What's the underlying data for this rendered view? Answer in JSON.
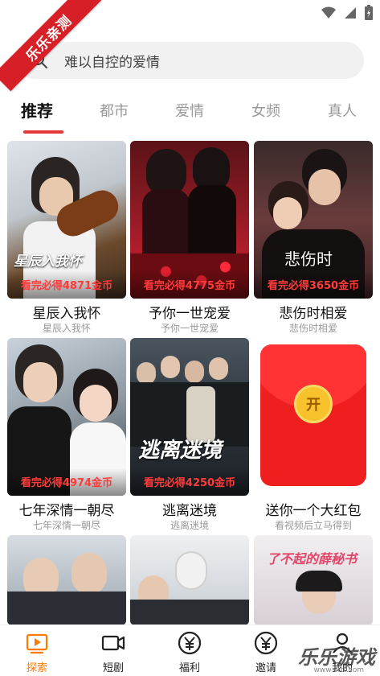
{
  "ribbon": "乐乐亲测",
  "search": {
    "placeholder": "难以自控的爱情"
  },
  "tabs": [
    {
      "label": "推荐",
      "active": true
    },
    {
      "label": "都市"
    },
    {
      "label": "爱情"
    },
    {
      "label": "女频"
    },
    {
      "label": "真人"
    }
  ],
  "cards": [
    {
      "title": "星辰入我怀",
      "sub": "星辰入我怀",
      "coin": "看完必得4871金币",
      "poster_text": "星辰入我怀"
    },
    {
      "title": "予你一世宠爱",
      "sub": "予你一世宠爱",
      "coin": "看完必得4775金币",
      "poster_text": ""
    },
    {
      "title": "悲伤时相爱",
      "sub": "悲伤时相爱",
      "coin": "看完必得3650金币",
      "poster_text": "悲伤时"
    },
    {
      "title": "七年深情一朝尽",
      "sub": "七年深情一朝尽",
      "coin": "看完必得4974金币",
      "poster_text": ""
    },
    {
      "title": "逃离迷境",
      "sub": "逃离迷境",
      "coin": "看完必得4250金币",
      "poster_text": "逃离迷境"
    },
    {
      "title": "送你一个大红包",
      "sub": "看视频后立马得到",
      "coin": "",
      "poster_text": "开"
    },
    {
      "title": "",
      "sub": "",
      "coin": "",
      "poster_text": ""
    },
    {
      "title": "",
      "sub": "",
      "coin": "",
      "poster_text": ""
    },
    {
      "title": "",
      "sub": "",
      "coin": "",
      "poster_text": "了不起的薛秘书"
    }
  ],
  "nav": [
    {
      "label": "探索",
      "icon": "play-square-icon",
      "active": true
    },
    {
      "label": "短剧",
      "icon": "video-camera-icon"
    },
    {
      "label": "福利",
      "icon": "yen-circle-icon"
    },
    {
      "label": "邀请",
      "icon": "yen-circle-icon"
    },
    {
      "label": "我的",
      "icon": "user-icon"
    }
  ],
  "watermark": "乐乐游戏",
  "watermark_sub": "www.6ttt.com",
  "colors": {
    "accent": "#e53935",
    "nav_active": "#ff7a00",
    "coin_text": "#ff3b3b"
  }
}
